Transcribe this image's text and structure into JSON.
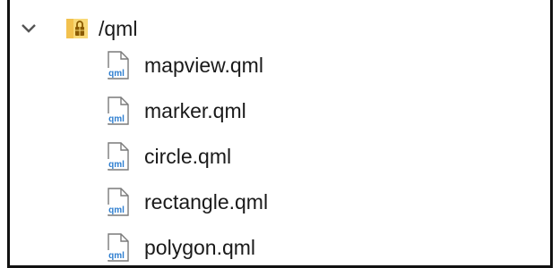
{
  "tree": {
    "root": {
      "label": "/qml",
      "expanded": true,
      "icon": "package-folder-icon"
    },
    "files": [
      {
        "label": "mapview.qml",
        "icon": "qml-file-icon"
      },
      {
        "label": "marker.qml",
        "icon": "qml-file-icon"
      },
      {
        "label": "circle.qml",
        "icon": "qml-file-icon"
      },
      {
        "label": "rectangle.qml",
        "icon": "qml-file-icon"
      },
      {
        "label": "polygon.qml",
        "icon": "qml-file-icon"
      }
    ],
    "file_icon_text": "qml"
  },
  "colors": {
    "text": "#1a1a1a",
    "qml_badge": "#2f7fd0",
    "folder": "#f2c14e",
    "lock": "#8a5a00",
    "chevron": "#555555"
  }
}
